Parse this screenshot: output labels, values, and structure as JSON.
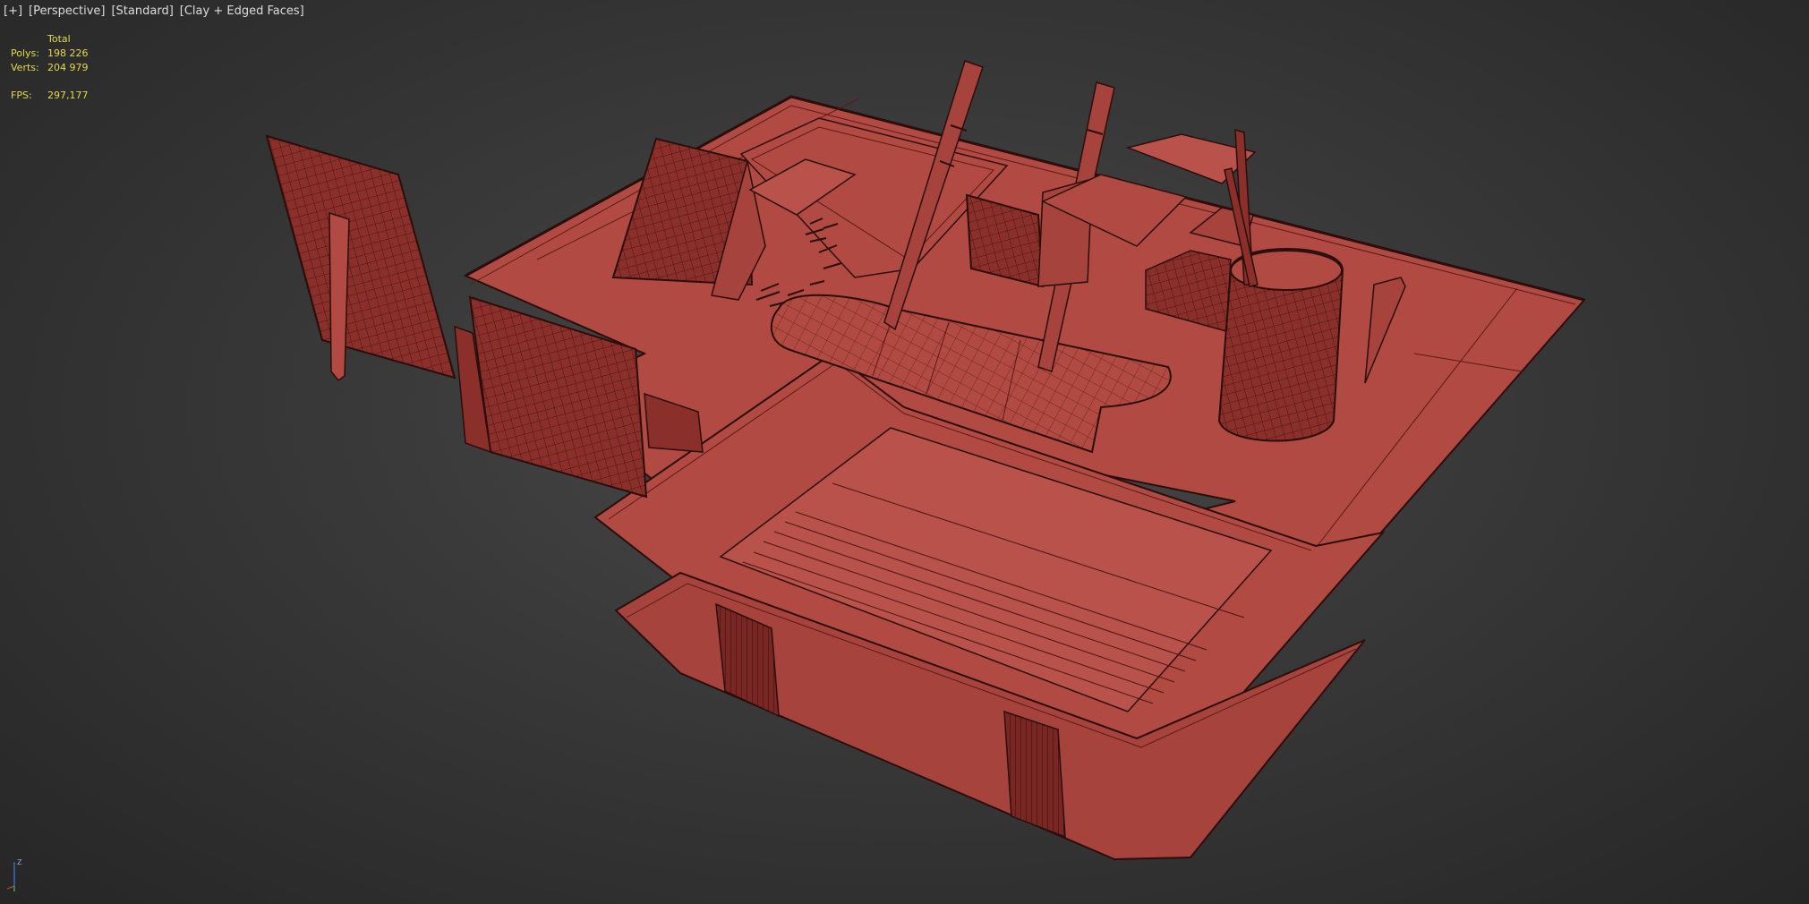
{
  "viewport": {
    "labels": [
      "[+]",
      "[Perspective]",
      "[Standard]",
      "[Clay + Edged Faces]"
    ]
  },
  "stats": {
    "header": "Total",
    "polys_label": "Polys:",
    "polys_value": "198 226",
    "verts_label": "Verts:",
    "verts_value": "204 979",
    "fps_label": "FPS:",
    "fps_value": "297,177"
  },
  "axis": {
    "z_label": "Z"
  },
  "colors": {
    "clay": "#b04a42",
    "clay_dark": "#8a2f2a",
    "clay_shadow": "#6e2220",
    "edge": "#2b0e0c",
    "stats_text": "#e6d94a",
    "label_text": "#dcdcdc"
  }
}
